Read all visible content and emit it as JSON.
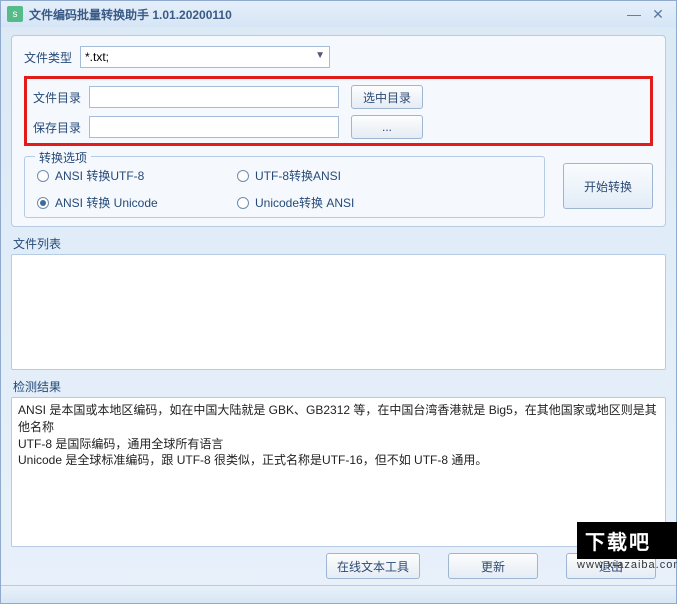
{
  "window": {
    "title": "文件编码批量转换助手 1.01.20200110"
  },
  "labels": {
    "fileType": "文件类型",
    "fileDir": "文件目录",
    "saveDir": "保存目录"
  },
  "fileType": {
    "value": "*.txt;"
  },
  "fileDir": {
    "value": ""
  },
  "saveDir": {
    "value": ""
  },
  "buttons": {
    "selectDir": "选中目录",
    "browse": "...",
    "start": "开始转换",
    "onlineTool": "在线文本工具",
    "update": "更新",
    "exit": "退出"
  },
  "convertOptions": {
    "legend": "转换选项",
    "selected": "ansi2unicode",
    "items": [
      {
        "key": "ansi2utf8",
        "label": "ANSI 转换UTF-8"
      },
      {
        "key": "utf82ansi",
        "label": "UTF-8转换ANSI"
      },
      {
        "key": "ansi2unicode",
        "label": "ANSI 转换 Unicode"
      },
      {
        "key": "unicode2ansi",
        "label": "Unicode转换 ANSI"
      }
    ]
  },
  "sections": {
    "fileList": "文件列表",
    "result": "检测结果"
  },
  "resultText": {
    "line1": "ANSI 是本国或本地区编码，如在中国大陆就是 GBK、GB2312 等，在中国台湾香港就是 Big5，在其他国家或地区则是其他名称",
    "line2": "UTF-8 是国际编码，通用全球所有语言",
    "line3": "Unicode 是全球标准编码，跟 UTF-8 很类似，正式名称是UTF-16，但不如 UTF-8 通用。"
  },
  "watermark": {
    "brand": "下载吧",
    "url": "www.xiazaiba.com"
  }
}
